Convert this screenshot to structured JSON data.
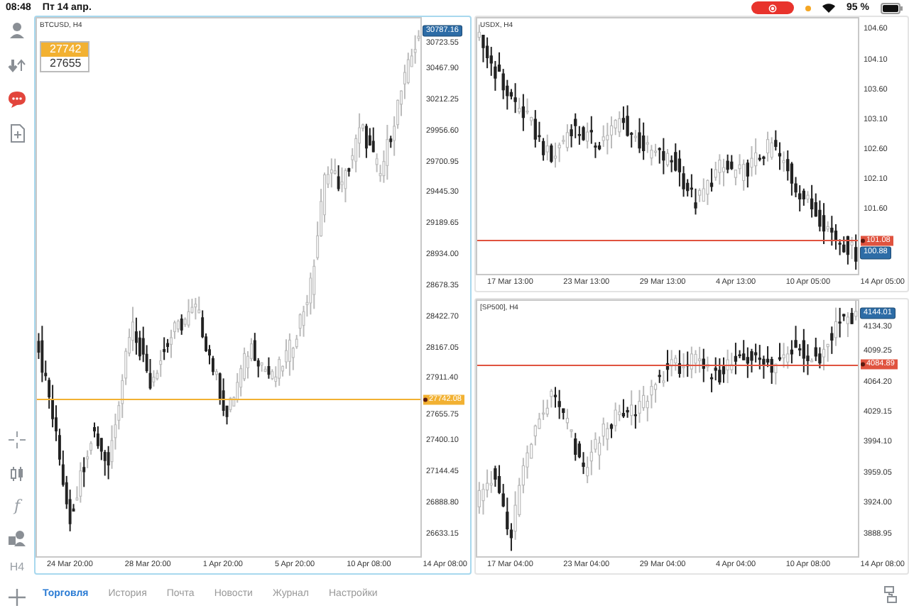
{
  "status_bar": {
    "time": "08:48",
    "date": "Пт 14 апр.",
    "battery": "95 %"
  },
  "sidebar": {
    "indicator_glyph": "f",
    "timeframe": "H4"
  },
  "charts": [
    {
      "title": "BTCUSD, H4",
      "selected": true,
      "one_click": {
        "ask": "27742",
        "bid": "27655"
      },
      "price_ticks": [
        "30723.55",
        "30467.90",
        "30212.25",
        "29956.60",
        "29700.95",
        "29445.30",
        "29189.65",
        "28934.00",
        "28678.35",
        "28422.70",
        "28167.05",
        "27911.40",
        "27655.75",
        "27400.10",
        "27144.45",
        "26888.80",
        "26633.15"
      ],
      "time_ticks": [
        "24 Mar 20:00",
        "28 Mar 20:00",
        "1 Apr 20:00",
        "5 Apr 20:00",
        "10 Apr 08:00",
        "14 Apr 08:00"
      ],
      "tags": [
        {
          "label": "30787.16",
          "color": "#2d6ca6",
          "line": false
        },
        {
          "label": "27742.08",
          "color": "#f2b132",
          "line": true
        }
      ]
    },
    {
      "title": "USDX, H4",
      "selected": false,
      "price_ticks": [
        "104.60",
        "104.10",
        "103.60",
        "103.10",
        "102.60",
        "102.10",
        "101.60"
      ],
      "time_ticks": [
        "17 Mar 13:00",
        "23 Mar 13:00",
        "29 Mar 13:00",
        "4 Apr 13:00",
        "10 Apr 05:00",
        "14 Apr 05:00"
      ],
      "tags": [
        {
          "label": "101.08",
          "color": "#e0533f",
          "line": true
        },
        {
          "label": "100.88",
          "color": "#2d6ca6",
          "line": false
        }
      ]
    },
    {
      "title": "[SP500], H4",
      "selected": false,
      "price_ticks": [
        "4134.30",
        "4099.25",
        "4064.20",
        "4029.15",
        "3994.10",
        "3959.05",
        "3924.00",
        "3888.95"
      ],
      "time_ticks": [
        "17 Mar 04:00",
        "23 Mar 04:00",
        "29 Mar 04:00",
        "4 Apr 04:00",
        "10 Apr 08:00",
        "14 Apr 08:00"
      ],
      "tags": [
        {
          "label": "4144.01",
          "color": "#2d6ca6",
          "line": false
        },
        {
          "label": "4084.89",
          "color": "#e0533f",
          "line": true
        }
      ]
    }
  ],
  "tabs": [
    {
      "label": "Торговля",
      "selected": true
    },
    {
      "label": "История",
      "selected": false
    },
    {
      "label": "Почта",
      "selected": false
    },
    {
      "label": "Новости",
      "selected": false
    },
    {
      "label": "Журнал",
      "selected": false
    },
    {
      "label": "Настройки",
      "selected": false
    }
  ]
}
